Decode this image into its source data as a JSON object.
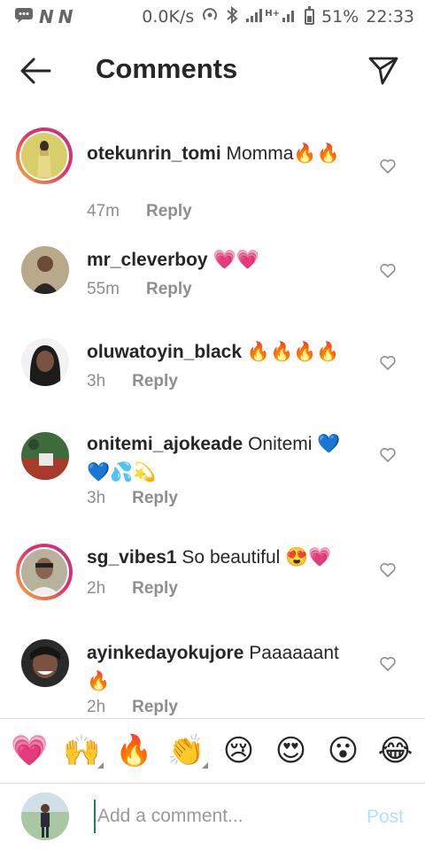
{
  "status_bar": {
    "speed": "0.0K/s",
    "network_label": "H+",
    "battery": "51%",
    "time": "22:33",
    "icons": [
      "message-icon",
      "notification-n-icon",
      "notification-n-icon",
      "hotspot-icon",
      "bluetooth-icon",
      "signal-icon",
      "signal-icon",
      "battery-icon"
    ]
  },
  "header": {
    "title": "Comments",
    "back_icon": "arrow-left-icon",
    "send_icon": "paper-plane-icon"
  },
  "comments": [
    {
      "username": "otekunrin_tomi",
      "text": "Momma🔥🔥",
      "time": "47m",
      "reply": "Reply",
      "story_ring": true,
      "avatar_colors": [
        "#c9c25a",
        "#3b3b2a"
      ]
    },
    {
      "username": "mr_cleverboy",
      "text": "💗💗",
      "time": "55m",
      "reply": "Reply",
      "story_ring": false,
      "avatar_colors": [
        "#8c6b4f",
        "#2d2d2d"
      ]
    },
    {
      "username": "oluwatoyin_black",
      "text": "🔥🔥🔥🔥",
      "time": "3h",
      "reply": "Reply",
      "story_ring": false,
      "avatar_colors": [
        "#1c1c1c",
        "#6d4a3a"
      ]
    },
    {
      "username": "onitemi_ajokeade",
      "text": "Onitemi 💙💙💦💫",
      "time": "3h",
      "reply": "Reply",
      "story_ring": false,
      "avatar_colors": [
        "#3e6b3c",
        "#a83a2c"
      ]
    },
    {
      "username": "sg_vibes1",
      "text": "So beautiful 😍💗",
      "time": "2h",
      "reply": "Reply",
      "story_ring": true,
      "avatar_colors": [
        "#8d8a78",
        "#3a2f2b"
      ]
    },
    {
      "username": "ayinkedayokujore",
      "text": "Paaaaaant🔥",
      "time": "2h",
      "reply": "Reply",
      "story_ring": false,
      "avatar_colors": [
        "#6a4a3a",
        "#1e1e1e"
      ]
    }
  ],
  "quick_emojis": [
    {
      "glyph": "💗",
      "name": "heart-emoji",
      "has_variants": false
    },
    {
      "glyph": "🙌",
      "name": "raising-hands-emoji",
      "has_variants": true
    },
    {
      "glyph": "🔥",
      "name": "fire-emoji",
      "has_variants": false
    },
    {
      "glyph": "👏",
      "name": "clapping-hands-emoji",
      "has_variants": true
    },
    {
      "glyph": "😢",
      "name": "crying-face-emoji",
      "has_variants": false
    },
    {
      "glyph": "😍",
      "name": "heart-eyes-emoji",
      "has_variants": false
    },
    {
      "glyph": "😮",
      "name": "surprised-face-emoji",
      "has_variants": false
    },
    {
      "glyph": "😂",
      "name": "tears-of-joy-emoji",
      "has_variants": false
    }
  ],
  "composer": {
    "placeholder": "Add a comment...",
    "value": "",
    "post_label": "Post",
    "post_color": "#b2dffc"
  },
  "colors": {
    "story_ring_start": "#f9b233",
    "story_ring_end": "#c13584",
    "text_primary": "#262626",
    "text_secondary": "#8e8e8e",
    "divider": "#dbdbdb"
  }
}
